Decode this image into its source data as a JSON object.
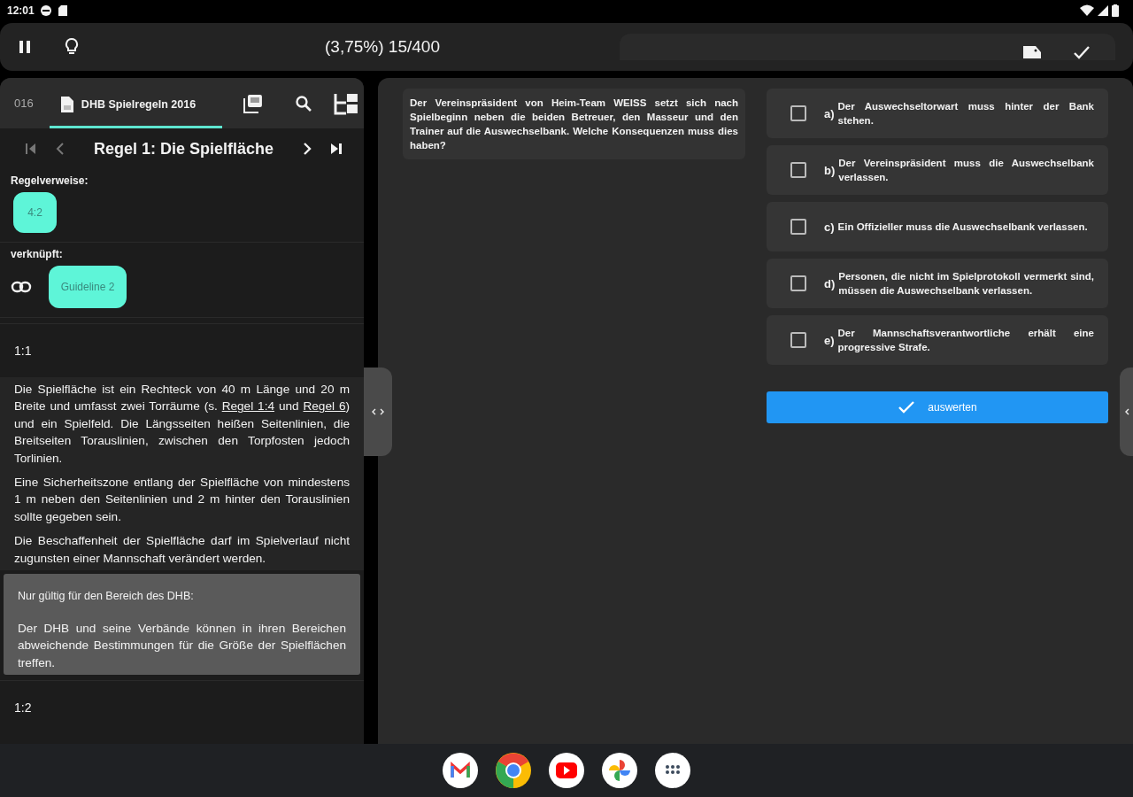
{
  "status_bar": {
    "time": "12:01"
  },
  "toolbar": {
    "title": "(3,75%) 15/400"
  },
  "rulebook": {
    "number": "016",
    "tabs": [
      {
        "label": "DHB Spielregeln 2016",
        "selected": true
      }
    ],
    "rule_title": "Regel 1: Die Spielfläche",
    "references_label": "Regelverweise:",
    "references": [
      "4:2"
    ],
    "linked_label": "verknüpft:",
    "linked": [
      "Guideline 2"
    ],
    "sections": [
      {
        "number": "1:1",
        "paragraphs": [
          [
            {
              "text": "Die Spielfläche ist ein Rechteck von 40 m Länge und 20 m Breite und umfasst zwei Torräume (s. "
            },
            {
              "text": "Regel 1:4",
              "kind": "link"
            },
            {
              "text": " und "
            },
            {
              "text": "Regel 6",
              "kind": "link"
            },
            {
              "text": ") und ein Spielfeld. Die Längsseiten heißen Seitenlinien, die Breitseiten Torauslinien, zwischen den Torpfosten jedoch Torlinien."
            }
          ],
          [
            {
              "text": "Eine Sicherheitszone entlang der Spielfläche von mindestens 1 m  neben den Seitenlinien und 2 m hinter den Torauslinien sollte gegeben  sein."
            }
          ],
          [
            {
              "text": "Die Beschaffenheit der Spielfläche darf im Spielverlauf nicht zugunsten einer Mannschaft verändert werden."
            }
          ]
        ],
        "note": {
          "title": "Nur gültig für den Bereich des DHB:",
          "text": "Der DHB und seine Verbände können in ihren Bereichen abweichende Bestimmungen für die Größe der Spielflächen treffen."
        }
      },
      {
        "number": "1:2"
      }
    ]
  },
  "question": {
    "text": "Der Vereinspräsident von Heim-Team WEISS setzt sich nach Spielbeginn neben die beiden Betreuer, den Masseur und den Trainer auf die Auswechselbank. Welche Konsequenzen muss dies haben?"
  },
  "answers": [
    {
      "letter": "a)",
      "text": "Der Auswechseltorwart muss hinter der Bank stehen.",
      "checked": false
    },
    {
      "letter": "b)",
      "text": "Der Vereinspräsident muss die Auswechselbank verlassen.",
      "checked": false
    },
    {
      "letter": "c)",
      "text": "Ein Offizieller muss die Auswechselbank verlassen.",
      "checked": false
    },
    {
      "letter": "d)",
      "text": "Personen, die nicht im Spielprotokoll vermerkt sind, müssen die Auswechselbank verlassen.",
      "checked": false
    },
    {
      "letter": "e)",
      "text": "Der Mannschaftsverantwortliche erhält eine progressive Strafe.",
      "checked": false
    }
  ],
  "evaluate_button": {
    "label": "auswerten"
  }
}
